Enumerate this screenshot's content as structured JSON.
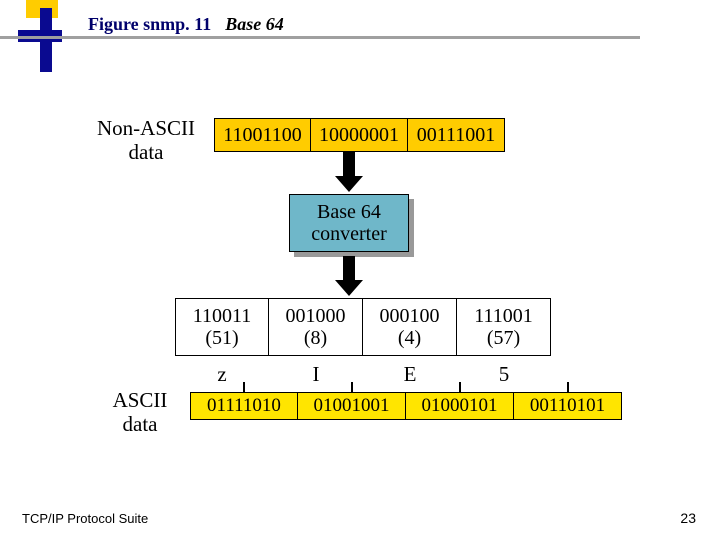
{
  "header": {
    "fig_label": "Figure snmp. 11",
    "fig_title": "Base 64"
  },
  "labels": {
    "nonascii": "Non-ASCII\ndata",
    "ascii": "ASCII\ndata",
    "converter": "Base 64\nconverter"
  },
  "input_bytes": [
    "11001100",
    "10000001",
    "00111001"
  ],
  "sixbit_groups": [
    {
      "bits": "110011",
      "dec": "(51)"
    },
    {
      "bits": "001000",
      "dec": "(8)"
    },
    {
      "bits": "000100",
      "dec": "(4)"
    },
    {
      "bits": "111001",
      "dec": "(57)"
    }
  ],
  "base64_chars": [
    "z",
    "I",
    "E",
    "5"
  ],
  "output_bytes": [
    "01111010",
    "01001001",
    "01000101",
    "00110101"
  ],
  "footer": {
    "left": "TCP/IP Protocol Suite",
    "page": "23"
  }
}
